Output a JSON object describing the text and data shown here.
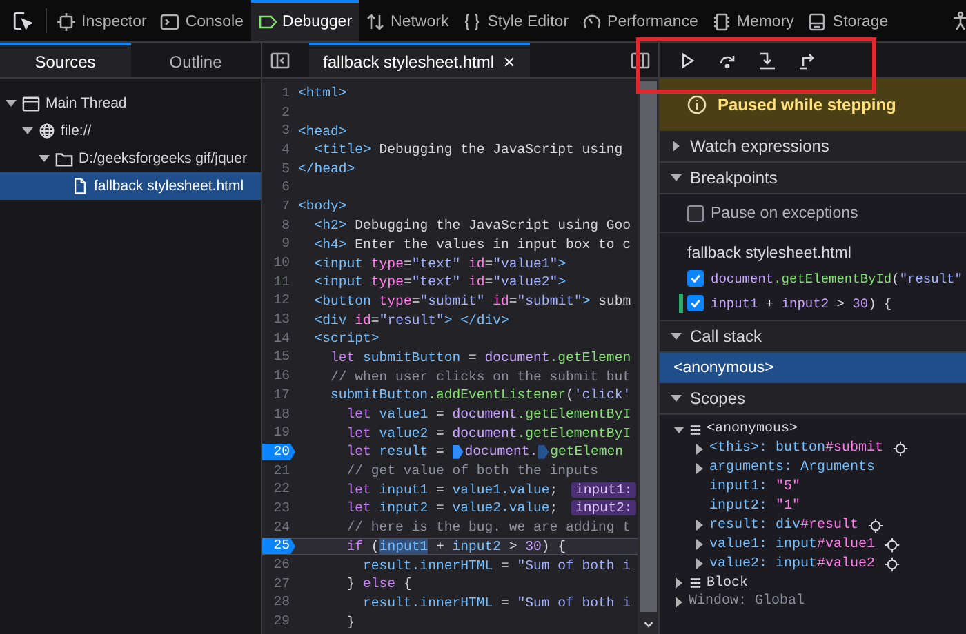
{
  "toolbar": {
    "tabs": [
      {
        "label": "Inspector",
        "selected": false
      },
      {
        "label": "Console",
        "selected": false
      },
      {
        "label": "Debugger",
        "selected": true
      },
      {
        "label": "Network",
        "selected": false
      },
      {
        "label": "Style Editor",
        "selected": false
      },
      {
        "label": "Performance",
        "selected": false
      },
      {
        "label": "Memory",
        "selected": false
      },
      {
        "label": "Storage",
        "selected": false
      }
    ]
  },
  "sidebar": {
    "tabs": [
      {
        "label": "Sources",
        "selected": true
      },
      {
        "label": "Outline",
        "selected": false
      }
    ],
    "tree": [
      {
        "label": "Main Thread",
        "expanded": true,
        "selected": false,
        "children": [
          {
            "label": "file://",
            "expanded": true,
            "selected": false,
            "children": [
              {
                "label": "D:/geeksforgeeks gif/jquer",
                "expanded": true,
                "selected": false,
                "children": [
                  {
                    "label": "fallback stylesheet.html",
                    "selected": true
                  }
                ]
              }
            ]
          }
        ]
      }
    ]
  },
  "editor": {
    "tabs": [
      {
        "label": "fallback stylesheet.html",
        "selected": true
      }
    ],
    "lines": [
      {
        "number": "1",
        "breakpoint": false,
        "paused": false,
        "tokens": [
          {
            "kind": "tag",
            "text": "<html>"
          }
        ]
      },
      {
        "number": "2",
        "breakpoint": false,
        "paused": false
      },
      {
        "number": "3",
        "breakpoint": false,
        "paused": false,
        "tokens": [
          {
            "kind": "tag",
            "text": "<head>"
          }
        ]
      },
      {
        "number": "4",
        "breakpoint": false,
        "paused": false,
        "tokens": [
          {
            "kind": "tag",
            "text": "  <title>"
          },
          {
            "kind": "text",
            "text": " Debugging the JavaScript using"
          }
        ]
      },
      {
        "number": "5",
        "breakpoint": false,
        "paused": false,
        "tokens": [
          {
            "kind": "tag",
            "text": "</head>"
          }
        ]
      },
      {
        "number": "6",
        "breakpoint": false,
        "paused": false
      },
      {
        "number": "7",
        "breakpoint": false,
        "paused": false,
        "tokens": [
          {
            "kind": "tag",
            "text": "<body>"
          }
        ]
      },
      {
        "number": "8",
        "breakpoint": false,
        "paused": false,
        "tokens": [
          {
            "kind": "tag",
            "text": "  <h2>"
          },
          {
            "kind": "text",
            "text": " Debugging the JavaScript using Goo"
          }
        ]
      },
      {
        "number": "9",
        "breakpoint": false,
        "paused": false,
        "tokens": [
          {
            "kind": "tag",
            "text": "  <h4>"
          },
          {
            "kind": "text",
            "text": " Enter the values in input box to c"
          }
        ]
      },
      {
        "number": "10",
        "breakpoint": false,
        "paused": false,
        "tokens": [
          {
            "kind": "tag",
            "text": "  <input"
          },
          {
            "kind": "attr",
            "text": " type"
          },
          {
            "kind": "text",
            "text": "="
          },
          {
            "kind": "string",
            "text": "\"text\""
          },
          {
            "kind": "attr",
            "text": " id"
          },
          {
            "kind": "text",
            "text": "="
          },
          {
            "kind": "string",
            "text": "\"value1\""
          },
          {
            "kind": "tag",
            "text": ">"
          }
        ]
      },
      {
        "number": "11",
        "breakpoint": false,
        "paused": false,
        "tokens": [
          {
            "kind": "tag",
            "text": "  <input"
          },
          {
            "kind": "attr",
            "text": " type"
          },
          {
            "kind": "text",
            "text": "="
          },
          {
            "kind": "string",
            "text": "\"text\""
          },
          {
            "kind": "attr",
            "text": " id"
          },
          {
            "kind": "text",
            "text": "="
          },
          {
            "kind": "string",
            "text": "\"value2\""
          },
          {
            "kind": "tag",
            "text": ">"
          }
        ]
      },
      {
        "number": "12",
        "breakpoint": false,
        "paused": false,
        "tokens": [
          {
            "kind": "tag",
            "text": "  <button"
          },
          {
            "kind": "attr",
            "text": " type"
          },
          {
            "kind": "text",
            "text": "="
          },
          {
            "kind": "string",
            "text": "\"submit\""
          },
          {
            "kind": "attr",
            "text": " id"
          },
          {
            "kind": "text",
            "text": "="
          },
          {
            "kind": "string",
            "text": "\"submit\""
          },
          {
            "kind": "tag",
            "text": ">"
          },
          {
            "kind": "text",
            "text": " subm"
          }
        ]
      },
      {
        "number": "13",
        "breakpoint": false,
        "paused": false,
        "tokens": [
          {
            "kind": "tag",
            "text": "  <div"
          },
          {
            "kind": "attr",
            "text": " id"
          },
          {
            "kind": "text",
            "text": "="
          },
          {
            "kind": "string",
            "text": "\"result\""
          },
          {
            "kind": "tag",
            "text": "> </div>"
          }
        ]
      },
      {
        "number": "14",
        "breakpoint": false,
        "paused": false,
        "tokens": [
          {
            "kind": "tag",
            "text": "  <script>"
          }
        ]
      },
      {
        "number": "15",
        "breakpoint": false,
        "paused": false,
        "tokens": [
          {
            "kind": "keyword",
            "text": "    let"
          },
          {
            "kind": "variable",
            "text": " submitButton"
          },
          {
            "kind": "text",
            "text": " = "
          },
          {
            "kind": "object",
            "text": "document"
          },
          {
            "kind": "method",
            "text": ".getElemen"
          }
        ]
      },
      {
        "number": "16",
        "breakpoint": false,
        "paused": false,
        "tokens": [
          {
            "kind": "comment",
            "text": "    // when user clicks on the submit but"
          }
        ]
      },
      {
        "number": "17",
        "breakpoint": false,
        "paused": false,
        "tokens": [
          {
            "kind": "variable",
            "text": "    submitButton"
          },
          {
            "kind": "method",
            "text": ".addEventListener"
          },
          {
            "kind": "text",
            "text": "("
          },
          {
            "kind": "string",
            "text": "'click'"
          }
        ]
      },
      {
        "number": "18",
        "breakpoint": false,
        "paused": false,
        "tokens": [
          {
            "kind": "keyword",
            "text": "      let"
          },
          {
            "kind": "variable",
            "text": " value1"
          },
          {
            "kind": "text",
            "text": " = "
          },
          {
            "kind": "object",
            "text": "document"
          },
          {
            "kind": "method",
            "text": ".getElementByI"
          }
        ]
      },
      {
        "number": "19",
        "breakpoint": false,
        "paused": false,
        "tokens": [
          {
            "kind": "keyword",
            "text": "      let"
          },
          {
            "kind": "variable",
            "text": " value2"
          },
          {
            "kind": "text",
            "text": " = "
          },
          {
            "kind": "object",
            "text": "document"
          },
          {
            "kind": "method",
            "text": ".getElementByI"
          }
        ]
      },
      {
        "number": "20",
        "breakpoint": true,
        "paused": false,
        "tokens": [
          {
            "kind": "keyword",
            "text": "      let"
          },
          {
            "kind": "variable",
            "text": " result"
          },
          {
            "kind": "text",
            "text": " = "
          },
          {
            "kind": "column_breakpoint",
            "enabled": true
          },
          {
            "kind": "object",
            "text": "document."
          },
          {
            "kind": "column_breakpoint",
            "enabled": false
          },
          {
            "kind": "method",
            "text": "getElemen"
          }
        ]
      },
      {
        "number": "21",
        "breakpoint": false,
        "paused": false,
        "tokens": [
          {
            "kind": "comment",
            "text": "      // get value of both the inputs"
          }
        ]
      },
      {
        "number": "22",
        "breakpoint": false,
        "paused": false,
        "tokens": [
          {
            "kind": "keyword",
            "text": "      let"
          },
          {
            "kind": "variable",
            "text": " input1"
          },
          {
            "kind": "text",
            "text": " = "
          },
          {
            "kind": "variable",
            "text": "value1.value"
          },
          {
            "kind": "text",
            "text": "; "
          },
          {
            "kind": "preview",
            "text": "input1:"
          }
        ]
      },
      {
        "number": "23",
        "breakpoint": false,
        "paused": false,
        "tokens": [
          {
            "kind": "keyword",
            "text": "      let"
          },
          {
            "kind": "variable",
            "text": " input2"
          },
          {
            "kind": "text",
            "text": " = "
          },
          {
            "kind": "variable",
            "text": "value2.value"
          },
          {
            "kind": "text",
            "text": "; "
          },
          {
            "kind": "preview",
            "text": "input2:"
          }
        ]
      },
      {
        "number": "24",
        "breakpoint": false,
        "paused": false,
        "tokens": [
          {
            "kind": "comment",
            "text": "      // here is the bug. we are adding t"
          }
        ]
      },
      {
        "number": "25",
        "breakpoint": true,
        "paused": true,
        "tokens": [
          {
            "kind": "keyword",
            "text": "      if"
          },
          {
            "kind": "text",
            "text": " ("
          },
          {
            "kind": "selection",
            "text": "input1"
          },
          {
            "kind": "text",
            "text": " + "
          },
          {
            "kind": "variable",
            "text": "input2"
          },
          {
            "kind": "text",
            "text": " > "
          },
          {
            "kind": "number",
            "text": "30"
          },
          {
            "kind": "text",
            "text": ") {"
          }
        ]
      },
      {
        "number": "26",
        "breakpoint": false,
        "paused": false,
        "tokens": [
          {
            "kind": "variable",
            "text": "        result.innerHTML"
          },
          {
            "kind": "text",
            "text": " = "
          },
          {
            "kind": "string",
            "text": "\"Sum of both i"
          }
        ]
      },
      {
        "number": "27",
        "breakpoint": false,
        "paused": false,
        "tokens": [
          {
            "kind": "text",
            "text": "      } "
          },
          {
            "kind": "keyword",
            "text": "else"
          },
          {
            "kind": "text",
            "text": " {"
          }
        ]
      },
      {
        "number": "28",
        "breakpoint": false,
        "paused": false,
        "tokens": [
          {
            "kind": "variable",
            "text": "        result.innerHTML"
          },
          {
            "kind": "text",
            "text": " = "
          },
          {
            "kind": "string",
            "text": "\"Sum of both i"
          }
        ]
      },
      {
        "number": "29",
        "breakpoint": false,
        "paused": false,
        "tokens": [
          {
            "kind": "text",
            "text": "      }"
          }
        ]
      }
    ]
  },
  "right_panel": {
    "banner": "Paused while stepping",
    "watch_expressions": {
      "title": "Watch expressions",
      "expanded": false
    },
    "breakpoints": {
      "title": "Breakpoints",
      "expanded": true,
      "pause_on_exceptions": {
        "label": "Pause on exceptions",
        "checked": false
      },
      "file": "fallback stylesheet.html",
      "items": [
        {
          "checked": true,
          "paused": false,
          "tokens": [
            {
              "kind": "object",
              "text": "document"
            },
            {
              "kind": "method",
              "text": ".getElementById"
            },
            {
              "kind": "text",
              "text": "("
            },
            {
              "kind": "string",
              "text": "\"result\""
            }
          ]
        },
        {
          "checked": true,
          "paused": true,
          "tokens": [
            {
              "kind": "object",
              "text": "input1"
            },
            {
              "kind": "text",
              "text": " + "
            },
            {
              "kind": "object",
              "text": "input2"
            },
            {
              "kind": "text",
              "text": " > "
            },
            {
              "kind": "number",
              "text": "30"
            },
            {
              "kind": "text",
              "text": ") {"
            }
          ]
        }
      ]
    },
    "call_stack": {
      "title": "Call stack",
      "expanded": true,
      "frames": [
        {
          "label": "<anonymous>",
          "selected": true
        }
      ]
    },
    "scopes": {
      "title": "Scopes",
      "expanded": true,
      "tree": [
        {
          "kind": "scope",
          "name": "<anonymous>",
          "expanded": true,
          "children": [
            {
              "kind": "variable",
              "name": "<this>:",
              "value": "button",
              "selector": "#submit",
              "expanded": false,
              "inspectable": true
            },
            {
              "kind": "variable",
              "name": "arguments:",
              "value": "Arguments",
              "expanded": false,
              "inspectable": false
            },
            {
              "kind": "variable",
              "name": "input1:",
              "string": "\"5\"",
              "inspectable": false
            },
            {
              "kind": "variable",
              "name": "input2:",
              "string": "\"1\"",
              "inspectable": false
            },
            {
              "kind": "variable",
              "name": "result:",
              "value": "div",
              "selector": "#result",
              "expanded": false,
              "inspectable": true
            },
            {
              "kind": "variable",
              "name": "value1:",
              "value": "input",
              "selector": "#value1",
              "expanded": false,
              "inspectable": true
            },
            {
              "kind": "variable",
              "name": "value2:",
              "value": "input",
              "selector": "#value2",
              "expanded": false,
              "inspectable": true
            }
          ]
        },
        {
          "kind": "scope",
          "name": "Block",
          "expanded": false
        },
        {
          "kind": "global",
          "name": "Window: Global",
          "expanded": false
        }
      ]
    }
  }
}
